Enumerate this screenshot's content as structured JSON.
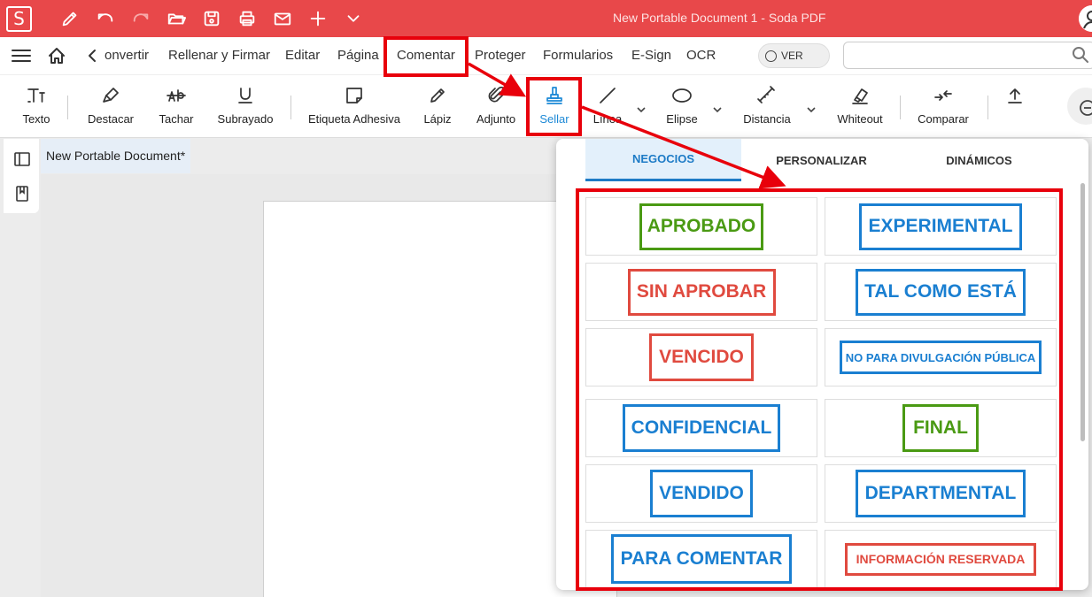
{
  "titlebar": {
    "logo": "S",
    "title": "New Portable Document 1   -   Soda PDF",
    "quick_actions": [
      "pen-icon",
      "undo-icon",
      "redo-icon",
      "open-folder-icon",
      "save-icon",
      "print-icon",
      "mail-icon",
      "plus-icon",
      "chevron-down-icon"
    ],
    "colors": {
      "bar": "#e8484a"
    }
  },
  "menubar": {
    "items": [
      "onvertir",
      "Rellenar y Firmar",
      "Editar",
      "Página",
      "Comentar",
      "Proteger",
      "Formularios",
      "E-Sign",
      "OCR"
    ],
    "active": "Comentar",
    "toggle_label": "VER",
    "search_placeholder": ""
  },
  "ribbon": {
    "tools": [
      "Texto",
      "Destacar",
      "Tachar",
      "Subrayado",
      "Etiqueta Adhesiva",
      "Lápiz",
      "Adjunto",
      "Sellar",
      "Línea",
      "Elipse",
      "Distancia",
      "Whiteout",
      "Comparar"
    ],
    "active": "Sellar",
    "colors": {
      "active": "#1d89d6"
    }
  },
  "document": {
    "tab_label": "New Portable Document*"
  },
  "stamp_panel": {
    "tabs": [
      "NEGOCIOS",
      "PERSONALIZAR",
      "DINÁMICOS"
    ],
    "active_tab": "NEGOCIOS",
    "stamps": [
      {
        "label": "APROBADO",
        "color": "green"
      },
      {
        "label": "EXPERIMENTAL",
        "color": "blue"
      },
      {
        "label": "SIN APROBAR",
        "color": "red"
      },
      {
        "label": "TAL COMO ESTÁ",
        "color": "blue"
      },
      {
        "label": "VENCIDO",
        "color": "red"
      },
      {
        "label": "NO PARA DIVULGACIÓN PÚBLICA",
        "color": "blue"
      },
      {
        "label": "CONFIDENCIAL",
        "color": "blue"
      },
      {
        "label": "FINAL",
        "color": "green"
      },
      {
        "label": "VENDIDO",
        "color": "blue"
      },
      {
        "label": "DEPARTMENTAL",
        "color": "blue"
      },
      {
        "label": "PARA COMENTAR",
        "color": "blue"
      },
      {
        "label": "INFORMACIÓN RESERVADA",
        "color": "red"
      }
    ],
    "colors": {
      "green": "#4a9a13",
      "blue": "#1a7fd1",
      "red": "#e04a3f"
    }
  },
  "annotation": {
    "highlight_color": "#e8000b"
  }
}
